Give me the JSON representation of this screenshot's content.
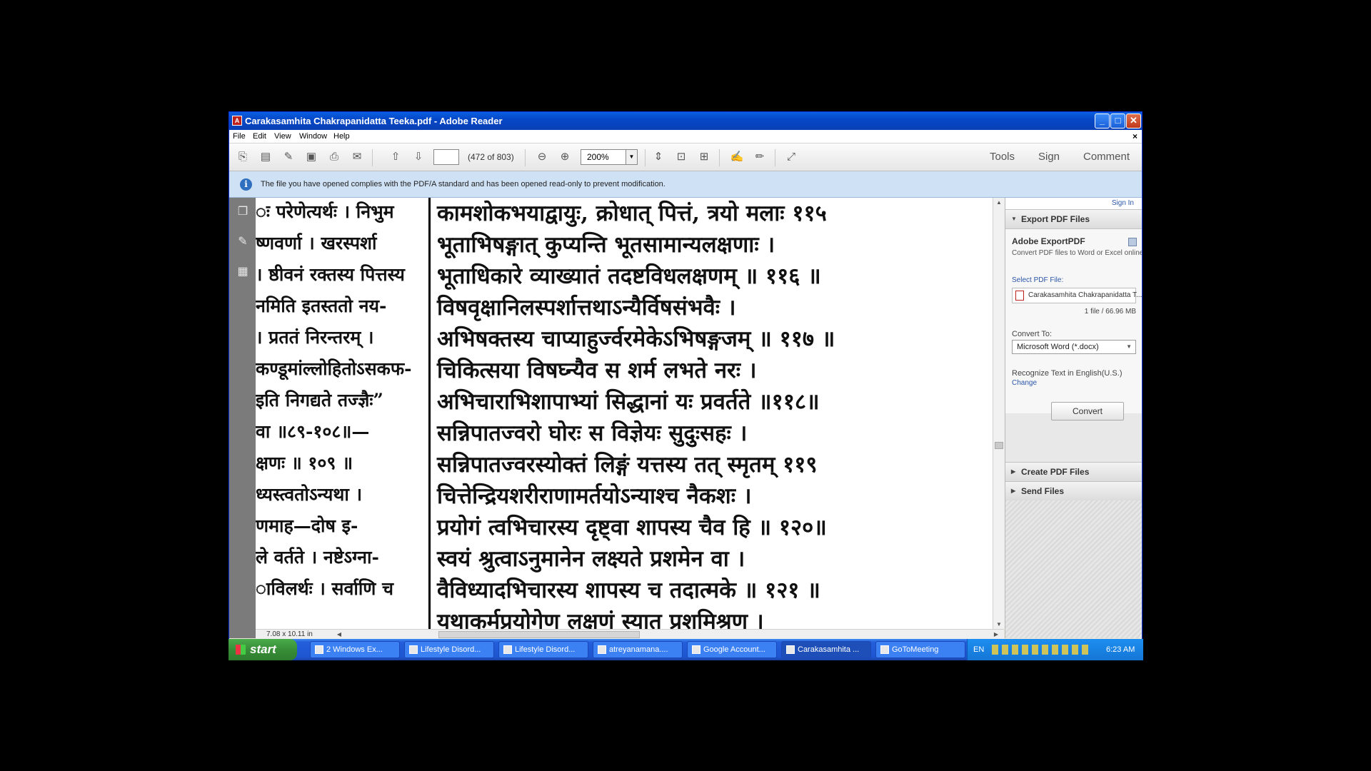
{
  "window": {
    "title": "Carakasamhita Chakrapanidatta Teeka.pdf - Adobe Reader",
    "min_label": "_",
    "max_label": "□",
    "close_label": "✕"
  },
  "menu": [
    "File",
    "Edit",
    "View",
    "Window",
    "Help"
  ],
  "menu_close": "×",
  "toolbar": {
    "page_input": "",
    "page_count": "(472 of 803)",
    "zoom": "200%",
    "tools": "Tools",
    "sign": "Sign",
    "comment": "Comment"
  },
  "infobar": {
    "text": "The file you have opened complies with the PDF/A standard and has been opened read-only to prevent modification."
  },
  "document": {
    "left_column_lines": [
      "ः परेणेत्यर्थः । निभुम",
      "ष्णवर्णा । खरस्पर्शा",
      "। ष्ठीवनं रक्तस्य पित्तस्य",
      "नमिति इतस्ततो नय-",
      "। प्रततं निरन्तरम् ।",
      "कण्डूमांल्लोहितोऽसकफ-",
      "इति निगद्यते तज्ज्ञैः”",
      "वा ॥८९-१०८॥—",
      "क्षणः ॥ १०९ ॥",
      "ध्यस्त्वतोऽन्यथा ।",
      "णमाह—दोष इ-",
      "ले वर्तते । नष्टेऽग्ना-",
      "ाविलर्थः । सर्वाणि च"
    ],
    "main_lines": [
      "कामशोकभयाद्वायुः, क्रोधात् पित्तं, त्रयो मलाः ११५",
      "भूताभिषङ्गात् कुप्यन्ति भूतसामान्यलक्षणाः ।",
      "भूताधिकारे व्याख्यातं तदष्टविधलक्षणम् ॥ ११६ ॥",
      "विषवृक्षानिलस्पर्शात्तथाऽन्यैर्विषसंभवैः ।",
      "अभिषक्तस्य चाप्याहुर्ज्वरमेकेऽभिषङ्गजम् ॥ ११७ ॥",
      "चिकित्सया विषघ्न्यैव स शर्म लभते नरः ।",
      "अभिचाराभिशापाभ्यां सिद्धानां यः प्रवर्तते ॥११८॥",
      "सन्निपातज्वरो घोरः स विज्ञेयः सुदुःसहः ।",
      "सन्निपातज्वरस्योक्तं लिङ्गं यत्तस्य तत् स्मृतम् ११९",
      "चित्तेन्द्रियशरीराणामर्तयोऽन्याश्च नैकशः ।",
      "प्रयोगं त्वभिचारस्य दृष्ट्वा शापस्य चैव हि ॥ १२०॥",
      "स्वयं श्रुत्वाऽनुमानेन लक्ष्यते प्रशमेन वा ।",
      "वैविध्यादभिचारस्य शापस्य च तदात्मके ॥ १२१ ॥",
      "यथाकर्मप्रयोगेण लक्षणं स्यात् प्रशमिश्रण ।"
    ],
    "page_size": "7.08 x 10.11 in"
  },
  "right_panel": {
    "sign_in": "Sign In",
    "export_header": "Export PDF Files",
    "export_title": "Adobe ExportPDF",
    "export_desc": "Convert PDF files to Word or Excel online.",
    "select_label": "Select PDF File:",
    "file_name": "Carakasamhita Chakrapanidatta T...",
    "file_info": "1 file / 66.96 MB",
    "convert_to_label": "Convert To:",
    "convert_to_value": "Microsoft Word (*.docx)",
    "recognize_text": "Recognize Text in English(U.S.)",
    "change_link": "Change",
    "convert_button": "Convert",
    "create_header": "Create PDF Files",
    "send_header": "Send Files"
  },
  "taskbar": {
    "start": "start",
    "items": [
      "2 Windows Ex...",
      "Lifestyle Disord...",
      "Lifestyle Disord...",
      "atreyanamana....",
      "Google Account...",
      "Carakasamhita ...",
      "GoToMeeting"
    ],
    "language": "EN",
    "clock": "6:23 AM"
  },
  "colors": {
    "title_blue": "#0548c8",
    "info_bar": "#cfe1f5",
    "nav_gray": "#7b7b7b",
    "start_green": "#388e38",
    "link_blue": "#2a55a8"
  }
}
